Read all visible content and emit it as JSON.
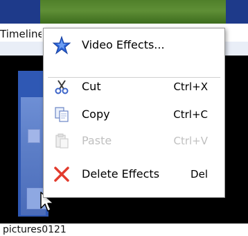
{
  "timeline_label": "Timeline",
  "clip_name": "pictures0121",
  "context_menu": {
    "items": [
      {
        "label": "Video Effects...",
        "shortcut": "",
        "icon": "star-icon",
        "enabled": true
      },
      {
        "label": "Cut",
        "shortcut": "Ctrl+X",
        "icon": "scissors-icon",
        "enabled": true
      },
      {
        "label": "Copy",
        "shortcut": "Ctrl+C",
        "icon": "copy-icon",
        "enabled": true
      },
      {
        "label": "Paste",
        "shortcut": "Ctrl+V",
        "icon": "paste-icon",
        "enabled": false
      },
      {
        "label": "Delete Effects",
        "shortcut": "Del",
        "icon": "delete-x-icon",
        "enabled": true
      }
    ]
  },
  "colors": {
    "menu_background": "#ffffff",
    "star_blue": "#2b63d6",
    "delete_red": "#e23b2d",
    "clip_blue": "#2f58b4",
    "top_strip": "#1e3a8a"
  }
}
